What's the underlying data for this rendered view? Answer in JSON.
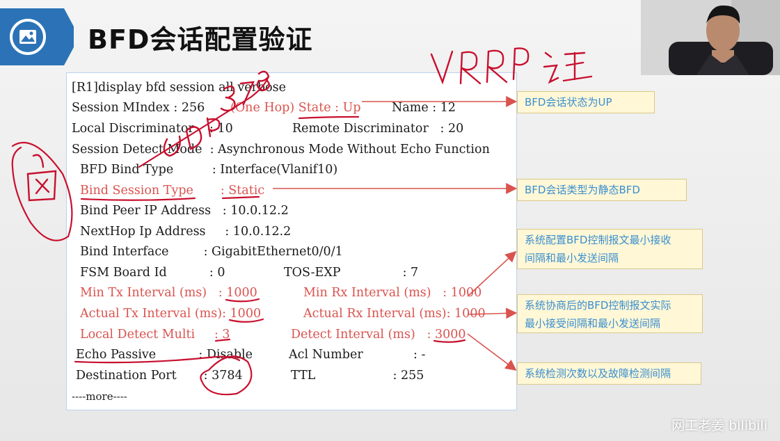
{
  "slide": {
    "title": "BFD会话配置验证",
    "icon": "image-icon",
    "accent": "#2b73b6"
  },
  "terminal": {
    "lines": [
      "[R1]display bfd session all verbose",
      "Session MIndex : 256",
      "(One Hop) State : Up",
      "Name : 12",
      "Local Discriminator    : 10",
      "Remote Discriminator   : 20",
      "Session Detect Mode  : Asynchronous Mode Without Echo Function",
      "BFD Bind Type          : Interface(Vlanif10)",
      "Bind Session Type       : Static",
      "Bind Peer IP Address   : 10.0.12.2",
      "NextHop Ip Address     : 10.0.12.2",
      "Bind Interface         : GigabitEthernet0/0/1",
      "FSM Board Id           : 0",
      "TOS-EXP                : 7",
      "Min Tx Interval (ms)   : 1000",
      "Min Rx Interval (ms)   : 1000",
      "Actual Tx Interval (ms): 1000",
      "Actual Rx Interval (ms): 1000",
      "Local Detect Multi     : 3",
      "Detect Interval (ms)   : 3000",
      "Echo Passive           : Disable",
      "Acl Number             : -",
      "Destination Port       : 3784",
      "TTL                    : 255",
      "----more----"
    ]
  },
  "callouts": {
    "state_up": "BFD会话状态为UP",
    "static_type": "BFD会话类型为静态BFD",
    "config_interval": [
      "系统配置BFD控制报文最小接收",
      "间隔和最小发送间隔"
    ],
    "actual_interval": [
      "系统协商后的BFD控制报文实际",
      "最小接受间隔和最小发送间隔"
    ],
    "detect": "系统检测次数以及故障检测间隔"
  },
  "handwriting": {
    "top": "VRRP 认证",
    "left": "图",
    "diagonal": "UDP 3784"
  },
  "watermark": "网工老姜 bilibili"
}
